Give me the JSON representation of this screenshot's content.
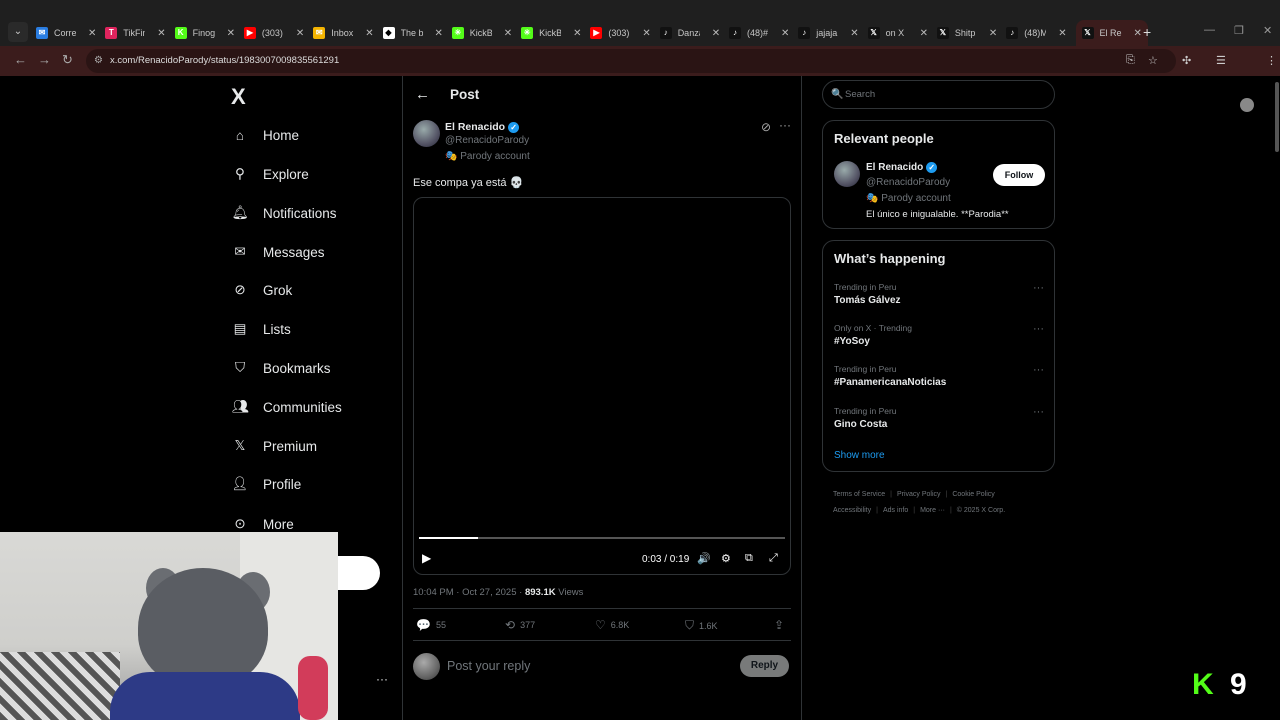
{
  "browser": {
    "tabs": [
      {
        "label": "Corre",
        "color": "#2a7de1",
        "glyph": "✉"
      },
      {
        "label": "TikFin",
        "color": "#e0245e",
        "glyph": "T"
      },
      {
        "label": "Finog",
        "color": "#53fc18",
        "glyph": "K"
      },
      {
        "label": "(303)",
        "color": "#ff0000",
        "glyph": "▶"
      },
      {
        "label": "Inbox",
        "color": "#f4b400",
        "glyph": "✉"
      },
      {
        "label": "The b",
        "color": "#ffffff",
        "glyph": "◆"
      },
      {
        "label": "KickB",
        "color": "#53fc18",
        "glyph": "✳"
      },
      {
        "label": "KickB",
        "color": "#53fc18",
        "glyph": "✳"
      },
      {
        "label": "(303)",
        "color": "#ff0000",
        "glyph": "▶"
      },
      {
        "label": "Danza",
        "color": "#111111",
        "glyph": "♪"
      },
      {
        "label": "(48)#",
        "color": "#111111",
        "glyph": "♪"
      },
      {
        "label": "jajaja",
        "color": "#111111",
        "glyph": "♪"
      },
      {
        "label": "on X",
        "color": "#111111",
        "glyph": "𝕏"
      },
      {
        "label": "Shitp",
        "color": "#111111",
        "glyph": "𝕏"
      },
      {
        "label": "(48)M",
        "color": "#111111",
        "glyph": "♪"
      },
      {
        "label": "El Ren",
        "color": "#111111",
        "glyph": "𝕏",
        "active": true
      }
    ],
    "url": "x.com/RenacidoParody/status/1983007009835561291"
  },
  "sidebar": {
    "logo": "X",
    "items": [
      {
        "label": "Home",
        "icon": "home-icon"
      },
      {
        "label": "Explore",
        "icon": "search-icon"
      },
      {
        "label": "Notifications",
        "icon": "bell-icon"
      },
      {
        "label": "Messages",
        "icon": "envelope-icon"
      },
      {
        "label": "Grok",
        "icon": "grok-icon"
      },
      {
        "label": "Lists",
        "icon": "list-icon"
      },
      {
        "label": "Bookmarks",
        "icon": "bookmark-icon"
      },
      {
        "label": "Communities",
        "icon": "communities-icon"
      },
      {
        "label": "Premium",
        "icon": "x-icon"
      },
      {
        "label": "Profile",
        "icon": "person-icon"
      },
      {
        "label": "More",
        "icon": "more-circle-icon"
      }
    ]
  },
  "post": {
    "header_title": "Post",
    "author_name": "El Renacido",
    "author_handle": "@RenacidoParody",
    "parody_label": "Parody account",
    "text": "Ese compa ya está 💀",
    "video": {
      "time": "0:03 / 0:19",
      "progress": 0.16
    },
    "timestamp": "10:04 PM · Oct 27, 2025 · ",
    "views_count": "893.1K",
    "views_label": " Views",
    "stats": {
      "replies": "55",
      "reposts": "377",
      "likes": "6.8K",
      "bookmarks": "1.6K"
    },
    "reply_placeholder": "Post your reply",
    "reply_button": "Reply"
  },
  "right": {
    "search_placeholder": "Search",
    "relevant_title": "Relevant people",
    "person": {
      "name": "El Renacido",
      "handle": "@RenacidoParody",
      "parody_label": "Parody account",
      "bio": "El único e inigualable. **Parodia**",
      "follow_label": "Follow"
    },
    "happening_title": "What’s happening",
    "trends": [
      {
        "context": "Trending in Peru",
        "name": "Tomás Gálvez"
      },
      {
        "context": "Only on X · Trending",
        "name": "#YoSoy"
      },
      {
        "context": "Trending in Peru",
        "name": "#PanamericanaNoticias"
      },
      {
        "context": "Trending in Peru",
        "name": "Gino Costa"
      }
    ],
    "show_more": "Show more",
    "footer": [
      "Terms of Service",
      "Privacy Policy",
      "Cookie Policy",
      "Accessibility",
      "Ads info",
      "More ···",
      "© 2025 X Corp."
    ]
  },
  "overlay": {
    "k_letter": "K",
    "k_number": "9",
    "k_color": "#53fc18"
  }
}
